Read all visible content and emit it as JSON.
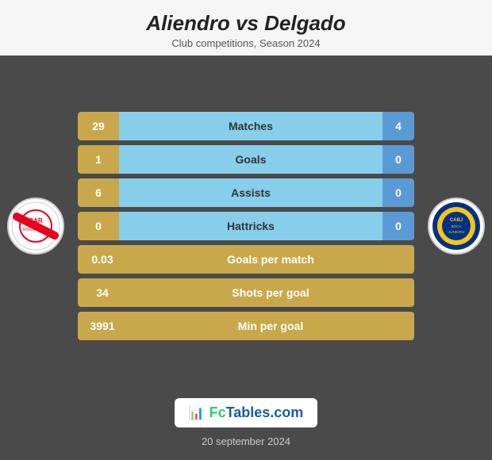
{
  "header": {
    "title": "Aliendro vs Delgado",
    "subtitle": "Club competitions, Season 2024"
  },
  "stats": [
    {
      "label": "Matches",
      "left": "29",
      "right": "4",
      "type": "split"
    },
    {
      "label": "Goals",
      "left": "1",
      "right": "0",
      "type": "split"
    },
    {
      "label": "Assists",
      "left": "6",
      "right": "0",
      "type": "split"
    },
    {
      "label": "Hattricks",
      "left": "0",
      "right": "0",
      "type": "split"
    },
    {
      "label": "Goals per match",
      "left": "0.03",
      "type": "single"
    },
    {
      "label": "Shots per goal",
      "left": "34",
      "type": "single"
    },
    {
      "label": "Min per goal",
      "left": "3991",
      "type": "single"
    }
  ],
  "watermark": {
    "text": "FcTables.com",
    "icon": "📊"
  },
  "footer": {
    "date": "20 september 2024"
  },
  "left_team": "River Plate",
  "right_team": "Boca Juniors"
}
